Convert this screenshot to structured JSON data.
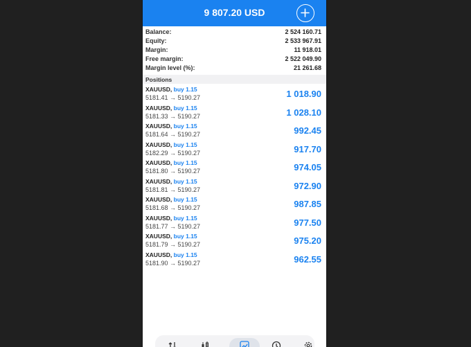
{
  "header": {
    "balance_title": "9 807.20 USD"
  },
  "summary": [
    {
      "label": "Balance:",
      "value": "2 524 160.71"
    },
    {
      "label": "Equity:",
      "value": "2 533 967.91"
    },
    {
      "label": "Margin:",
      "value": "11 918.01"
    },
    {
      "label": "Free margin:",
      "value": "2 522 049.90"
    },
    {
      "label": "Margin level (%):",
      "value": "21 261.68"
    }
  ],
  "positions_header": "Positions",
  "positions": [
    {
      "symbol": "XAUUSD,",
      "side": "buy 1.15",
      "prices": "5181.41 → 5190.27",
      "profit": "1 018.90"
    },
    {
      "symbol": "XAUUSD,",
      "side": "buy 1.15",
      "prices": "5181.33 → 5190.27",
      "profit": "1 028.10"
    },
    {
      "symbol": "XAUUSD,",
      "side": "buy 1.15",
      "prices": "5181.64 → 5190.27",
      "profit": "992.45"
    },
    {
      "symbol": "XAUUSD,",
      "side": "buy 1.15",
      "prices": "5182.29 → 5190.27",
      "profit": "917.70"
    },
    {
      "symbol": "XAUUSD,",
      "side": "buy 1.15",
      "prices": "5181.80 → 5190.27",
      "profit": "974.05"
    },
    {
      "symbol": "XAUUSD,",
      "side": "buy 1.15",
      "prices": "5181.81 → 5190.27",
      "profit": "972.90"
    },
    {
      "symbol": "XAUUSD,",
      "side": "buy 1.15",
      "prices": "5181.68 → 5190.27",
      "profit": "987.85"
    },
    {
      "symbol": "XAUUSD,",
      "side": "buy 1.15",
      "prices": "5181.77 → 5190.27",
      "profit": "977.50"
    },
    {
      "symbol": "XAUUSD,",
      "side": "buy 1.15",
      "prices": "5181.79 → 5190.27",
      "profit": "975.20"
    },
    {
      "symbol": "XAUUSD,",
      "side": "buy 1.15",
      "prices": "5181.90 → 5190.27",
      "profit": "962.55"
    }
  ],
  "icons": {
    "add": "plus-circle-icon",
    "tabs": [
      "quotes-icon",
      "chart-icon",
      "trade-icon",
      "history-icon",
      "settings-icon"
    ]
  },
  "colors": {
    "accent": "#1a82f0",
    "background": "#202020"
  }
}
